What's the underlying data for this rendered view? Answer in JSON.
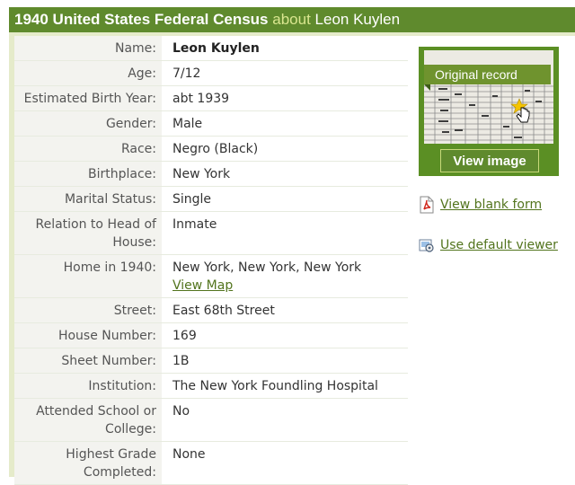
{
  "header": {
    "title_strong": "1940 United States Federal Census",
    "about_word": "about",
    "person_name": "Leon Kuylen"
  },
  "record": {
    "rows": [
      {
        "label": "Name:",
        "value": "Leon Kuylen",
        "bold": true
      },
      {
        "label": "Age:",
        "value": "7/12"
      },
      {
        "label": "Estimated Birth Year:",
        "value": "abt 1939"
      },
      {
        "label": "Gender:",
        "value": "Male"
      },
      {
        "label": "Race:",
        "value": "Negro (Black)"
      },
      {
        "label": "Birthplace:",
        "value": "New York"
      },
      {
        "label": "Marital Status:",
        "value": "Single"
      },
      {
        "label": "Relation to Head of House:",
        "value": "Inmate"
      },
      {
        "label": "Home in 1940:",
        "value": "New York, New York, New York",
        "link": "View Map"
      },
      {
        "label": "Street:",
        "value": "East 68th Street"
      },
      {
        "label": "House Number:",
        "value": "169"
      },
      {
        "label": "Sheet Number:",
        "value": "1B"
      },
      {
        "label": "Institution:",
        "value": "The New York Foundling Hospital"
      },
      {
        "label": "Attended School or College:",
        "value": "No"
      },
      {
        "label": "Highest Grade Completed:",
        "value": "None"
      }
    ]
  },
  "sidebar": {
    "ribbon_label": "Original record",
    "view_image_label": "View image",
    "blank_form_label": "View blank form",
    "default_viewer_label": "Use default viewer"
  },
  "colors": {
    "header_bg": "#5f8a2d",
    "about_text": "#d9e68f",
    "label_bg": "#f3f3ef",
    "link": "#52741d"
  },
  "icons": {
    "blank_form": "pdf-icon",
    "default_viewer": "viewer-icon",
    "thumbnail_badge": "star-icon",
    "thumbnail_cursor": "hand-cursor-icon"
  }
}
